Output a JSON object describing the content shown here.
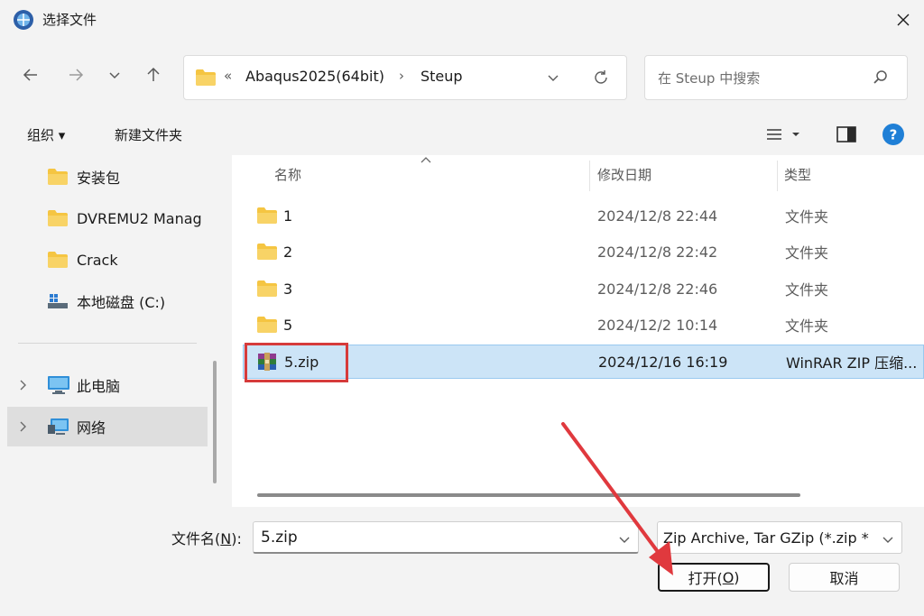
{
  "window": {
    "title": "选择文件"
  },
  "nav": {
    "breadcrumb_prefix": "«",
    "breadcrumb": [
      "Abaqus2025(64bit)",
      "Steup"
    ],
    "search_placeholder": "在 Steup 中搜索"
  },
  "toolbar": {
    "organize_label": "组织 ▾",
    "new_folder_label": "新建文件夹"
  },
  "sidebar": {
    "items": [
      {
        "label": "安装包",
        "icon": "folder-icon"
      },
      {
        "label": "DVREMU2 Manag",
        "icon": "folder-icon"
      },
      {
        "label": "Crack",
        "icon": "folder-icon"
      },
      {
        "label": "本地磁盘 (C:)",
        "icon": "drive-icon"
      },
      {
        "label": "此电脑",
        "icon": "computer-icon"
      },
      {
        "label": "网络",
        "icon": "network-icon"
      }
    ]
  },
  "columns": {
    "name": "名称",
    "date": "修改日期",
    "type": "类型"
  },
  "files": [
    {
      "name": "1",
      "date": "2024/12/8 22:44",
      "type": "文件夹",
      "icon": "folder-icon"
    },
    {
      "name": "2",
      "date": "2024/12/8 22:42",
      "type": "文件夹",
      "icon": "folder-icon"
    },
    {
      "name": "3",
      "date": "2024/12/8 22:46",
      "type": "文件夹",
      "icon": "folder-icon"
    },
    {
      "name": "5",
      "date": "2024/12/2 10:14",
      "type": "文件夹",
      "icon": "folder-icon"
    },
    {
      "name": "5.zip",
      "date": "2024/12/16 16:19",
      "type": "WinRAR ZIP 压缩...",
      "icon": "winrar-icon"
    }
  ],
  "footer": {
    "filename_label_main": "文件名(",
    "filename_label_key": "N",
    "filename_label_end": "):",
    "filename_value": "5.zip",
    "filetype_value": "Zip Archive, Tar GZip (*.zip *",
    "open_label_main": "打开(",
    "open_label_key": "O",
    "open_label_end": ")",
    "cancel_label": "取消"
  },
  "colors": {
    "selection": "#cce4f7",
    "highlight": "#d63b3b",
    "accent": "#0f6cbd",
    "folder": "#f5c542"
  }
}
